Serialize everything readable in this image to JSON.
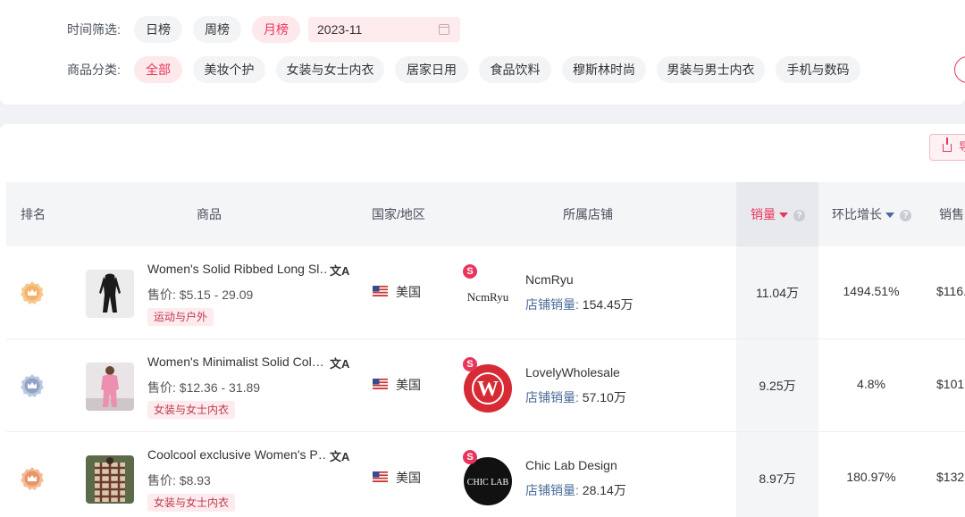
{
  "filters": {
    "time_label": "时间筛选:",
    "time_options": [
      "日榜",
      "周榜",
      "月榜"
    ],
    "time_active": "月榜",
    "date_value": "2023-11",
    "category_label": "商品分类:",
    "categories": [
      "全部",
      "美妆个护",
      "女装与女士内衣",
      "居家日用",
      "食品饮料",
      "穆斯林时尚",
      "男装与男士内衣",
      "手机与数码"
    ],
    "category_active": "全部"
  },
  "toolbar": {
    "export_label": "导"
  },
  "table": {
    "headers": {
      "rank": "排名",
      "product": "商品",
      "country": "国家/地区",
      "shop": "所属店铺",
      "sales": "销量",
      "growth": "环比增长",
      "amount": "销售"
    },
    "price_prefix": "售价:",
    "shop_sales_prefix": "店铺销量:",
    "rows": [
      {
        "product_name": "Women's Solid Ribbed Long Sl…",
        "price": "$5.15 - 29.09",
        "category_tag": "运动与户外",
        "country": "美国",
        "shop_name": "NcmRyu",
        "shop_logo_text": "NcmRyu",
        "shop_sales": "154.45万",
        "sales": "11.04万",
        "growth": "1494.51%",
        "amount": "$116."
      },
      {
        "product_name": "Women's Minimalist Solid Col…",
        "price": "$12.36 - 31.89",
        "category_tag": "女装与女士内衣",
        "country": "美国",
        "shop_name": "LovelyWholesale",
        "shop_logo_text": "W",
        "shop_sales": "57.10万",
        "sales": "9.25万",
        "growth": "4.8%",
        "amount": "$101."
      },
      {
        "product_name": "Coolcool exclusive Women's P…",
        "price": "$8.93",
        "category_tag": "女装与女士内衣",
        "country": "美国",
        "shop_name": "Chic Lab Design",
        "shop_logo_text": "CHIC LAB",
        "shop_sales": "28.14万",
        "sales": "8.97万",
        "growth": "180.97%",
        "amount": "$132."
      }
    ]
  },
  "colors": {
    "accent": "#e8355c",
    "rank1": "#f5b36a",
    "rank2": "#8fa3c9",
    "rank3": "#e8956a"
  }
}
